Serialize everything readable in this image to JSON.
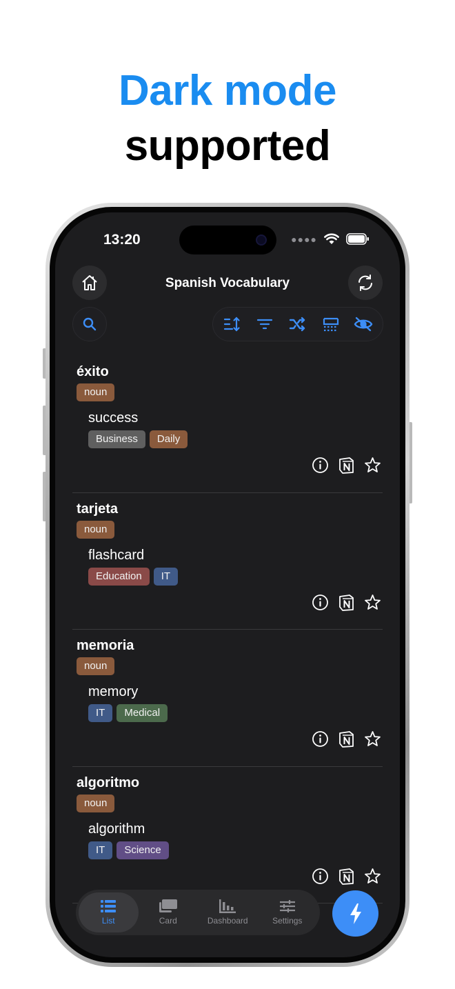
{
  "headline": {
    "line1": "Dark mode",
    "line2": "supported"
  },
  "status_bar": {
    "time": "13:20",
    "icons": [
      "cellular-dots-icon",
      "wifi-icon",
      "battery-icon"
    ]
  },
  "header": {
    "title": "Spanish Vocabulary",
    "left_icon": "home-icon",
    "right_icon": "sync-icon"
  },
  "toolbar": {
    "search_icon": "search-icon",
    "tools": [
      "sort-icon",
      "filter-icon",
      "shuffle-icon",
      "layout-icon",
      "hide-icon"
    ]
  },
  "colors": {
    "accent": "#3d8ef7",
    "headline_accent": "#1a8cf0",
    "screen_bg": "#1d1d1f"
  },
  "entries": [
    {
      "word": "éxito",
      "pos": "noun",
      "translation": "success",
      "tags": [
        {
          "label": "Business",
          "color": "#5f5f5f"
        },
        {
          "label": "Daily",
          "color": "#8a5a3c"
        }
      ]
    },
    {
      "word": "tarjeta",
      "pos": "noun",
      "translation": "flashcard",
      "tags": [
        {
          "label": "Education",
          "color": "#8a4a48"
        },
        {
          "label": "IT",
          "color": "#405a88"
        }
      ]
    },
    {
      "word": "memoria",
      "pos": "noun",
      "translation": "memory",
      "tags": [
        {
          "label": "IT",
          "color": "#405a88"
        },
        {
          "label": "Medical",
          "color": "#4c6a4c"
        }
      ]
    },
    {
      "word": "algoritmo",
      "pos": "noun",
      "translation": "algorithm",
      "tags": [
        {
          "label": "IT",
          "color": "#405a88"
        },
        {
          "label": "Science",
          "color": "#614e86"
        }
      ]
    }
  ],
  "entry_actions": [
    "info-icon",
    "notion-icon",
    "star-icon"
  ],
  "tabs": [
    {
      "label": "List",
      "icon": "list-icon",
      "active": true
    },
    {
      "label": "Card",
      "icon": "cards-icon",
      "active": false
    },
    {
      "label": "Dashboard",
      "icon": "chart-icon",
      "active": false
    },
    {
      "label": "Settings",
      "icon": "sliders-icon",
      "active": false
    }
  ],
  "fab_icon": "bolt-icon"
}
